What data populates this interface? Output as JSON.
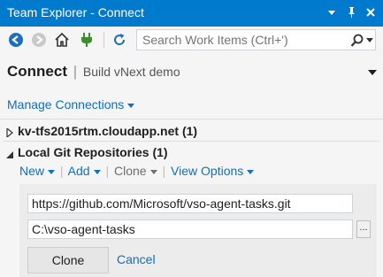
{
  "window": {
    "title": "Team Explorer - Connect",
    "accent": "#007acc"
  },
  "toolbar": {
    "search_placeholder": "Search Work Items (Ctrl+')",
    "icons": [
      "back-arrow-icon",
      "forward-arrow-icon",
      "home-icon",
      "plug-icon",
      "refresh-icon",
      "search-icon"
    ]
  },
  "header": {
    "title": "Connect",
    "separator": "|",
    "subtitle": "Build vNext demo"
  },
  "manage_connections": "Manage Connections",
  "server": {
    "label": "kv-tfs2015rtm.cloudapp.net (1)"
  },
  "repos": {
    "label": "Local Git Repositories (1)",
    "actions": {
      "new": "New",
      "add": "Add",
      "clone": "Clone",
      "view_options": "View Options",
      "separator": "|"
    }
  },
  "clone_form": {
    "url_value": "https://github.com/Microsoft/vso-agent-tasks.git",
    "path_value": "C:\\vso-agent-tasks",
    "browse_label": "...",
    "clone_button": "Clone",
    "cancel_link": "Cancel"
  },
  "colors": {
    "link": "#0e70c0",
    "disabled": "#6d6d6d"
  }
}
